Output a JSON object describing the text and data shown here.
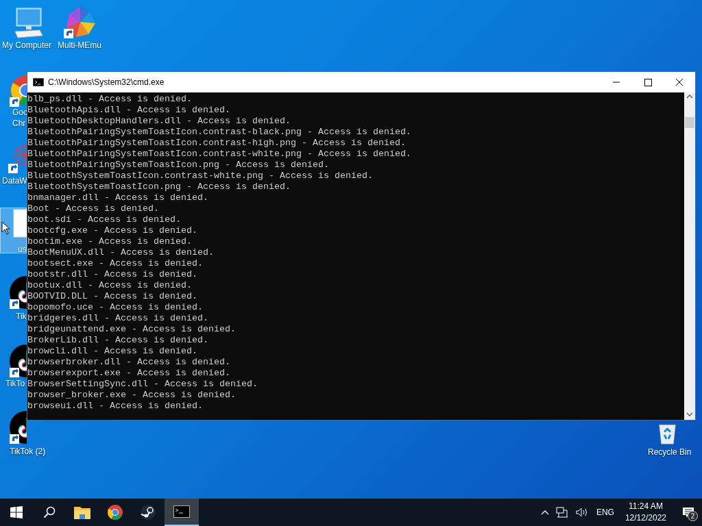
{
  "desktop_icons": [
    {
      "kind": "computer",
      "label_lines": [
        "My Computer"
      ],
      "selected": false
    },
    {
      "kind": "memu",
      "label_lines": [
        "Multi-MEmu"
      ],
      "selected": false
    },
    {
      "kind": "chrome",
      "label_lines": [
        "Goo",
        "Chr"
      ],
      "selected": false
    },
    {
      "kind": "datawrapper",
      "label_lines": [
        "DataW"
      ],
      "selected": false
    },
    {
      "kind": "file",
      "label_lines": [
        "us"
      ],
      "selected": true
    },
    {
      "kind": "tiktok",
      "label_lines": [
        "Tik"
      ],
      "selected": false
    },
    {
      "kind": "tiktok",
      "label_lines": [
        "TikTo"
      ],
      "selected": false
    },
    {
      "kind": "tiktok",
      "label_lines": [
        "TikTok (2)"
      ],
      "selected": false
    },
    {
      "kind": "recycle",
      "label_lines": [
        "Recycle Bin"
      ],
      "selected": false
    }
  ],
  "window": {
    "title": "C:\\Windows\\System32\\cmd.exe",
    "lines": [
      "blb_ps.dll - Access is denied.",
      "BluetoothApis.dll - Access is denied.",
      "BluetoothDesktopHandlers.dll - Access is denied.",
      "BluetoothPairingSystemToastIcon.contrast-black.png - Access is denied.",
      "BluetoothPairingSystemToastIcon.contrast-high.png - Access is denied.",
      "BluetoothPairingSystemToastIcon.contrast-white.png - Access is denied.",
      "BluetoothPairingSystemToastIcon.png - Access is denied.",
      "BluetoothSystemToastIcon.contrast-white.png - Access is denied.",
      "BluetoothSystemToastIcon.png - Access is denied.",
      "bnmanager.dll - Access is denied.",
      "Boot - Access is denied.",
      "boot.sdi - Access is denied.",
      "bootcfg.exe - Access is denied.",
      "bootim.exe - Access is denied.",
      "BootMenuUX.dll - Access is denied.",
      "bootsect.exe - Access is denied.",
      "bootstr.dll - Access is denied.",
      "bootux.dll - Access is denied.",
      "BOOTVID.DLL - Access is denied.",
      "bopomofo.uce - Access is denied.",
      "bridgeres.dll - Access is denied.",
      "bridgeunattend.exe - Access is denied.",
      "BrokerLib.dll - Access is denied.",
      "browcli.dll - Access is denied.",
      "browserbroker.dll - Access is denied.",
      "browserexport.exe - Access is denied.",
      "BrowserSettingSync.dll - Access is denied.",
      "browser_broker.exe - Access is denied.",
      "browseui.dll - Access is denied."
    ]
  },
  "taskbar": {
    "items": [
      {
        "kind": "start",
        "active": false
      },
      {
        "kind": "search",
        "active": false
      },
      {
        "kind": "explorer",
        "active": false
      },
      {
        "kind": "chrome",
        "active": false
      },
      {
        "kind": "steam",
        "active": false
      },
      {
        "kind": "cmd",
        "active": true
      }
    ],
    "language": "ENG",
    "time": "11:24 AM",
    "date": "12/12/2022",
    "notification_count": "2"
  }
}
